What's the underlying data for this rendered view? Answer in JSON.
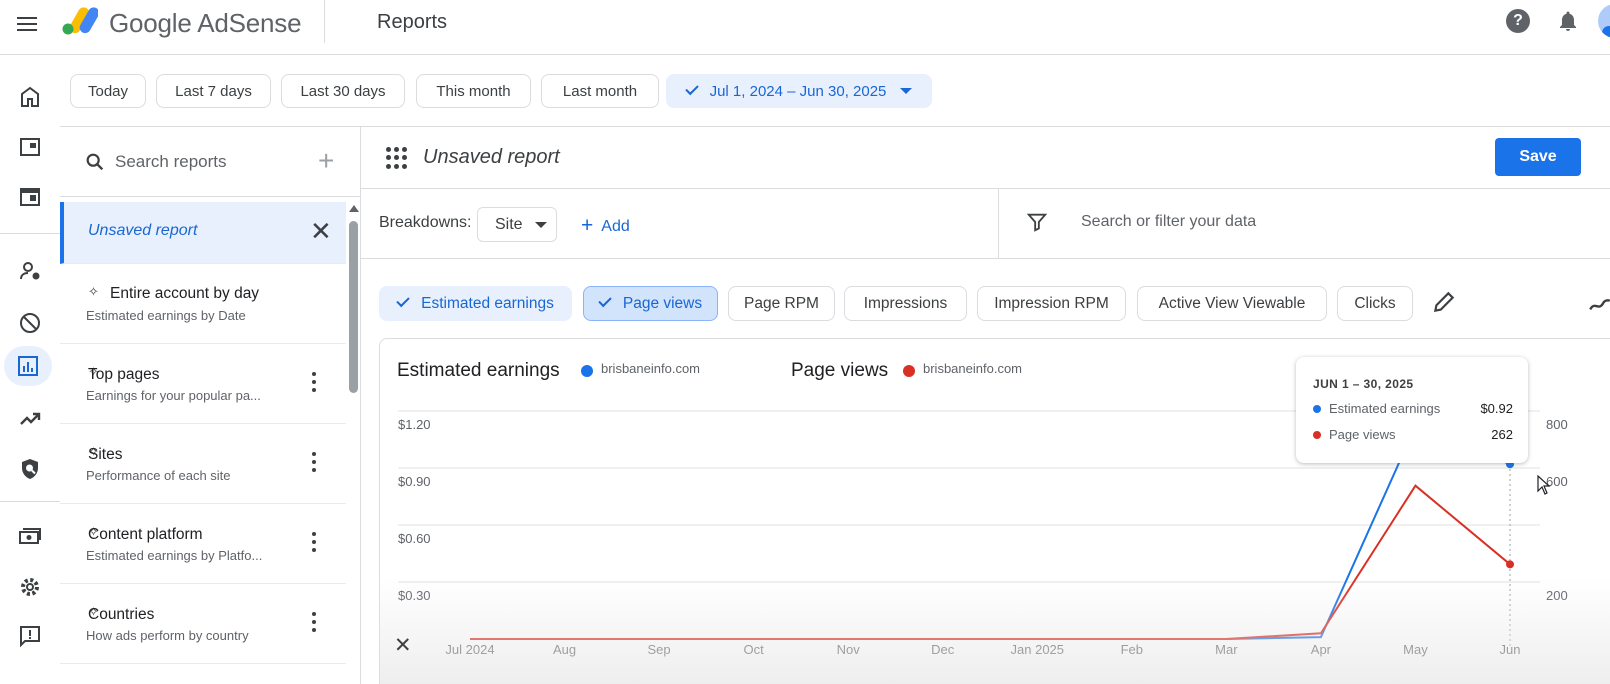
{
  "header": {
    "brand": "Google AdSense",
    "page_title": "Reports"
  },
  "rail": {
    "icons": [
      "home-icon",
      "ads-icon",
      "layout-icon",
      "users-icon",
      "block-icon",
      "reports-icon",
      "optimization-icon",
      "policy-icon",
      "payments-icon",
      "settings-icon",
      "feedback-icon"
    ],
    "active": "reports-icon"
  },
  "date_filters": {
    "chips": [
      "Today",
      "Last 7 days",
      "Last 30 days",
      "This month",
      "Last month"
    ],
    "selected_range": "Jul 1, 2024 – Jun 30, 2025"
  },
  "reports_panel": {
    "search_placeholder": "Search reports",
    "active_report": "Unsaved report",
    "items": [
      {
        "title": "Entire account by day",
        "subtitle": "Estimated earnings by Date"
      },
      {
        "title": "Top pages",
        "subtitle": "Earnings for your popular pa..."
      },
      {
        "title": "Sites",
        "subtitle": "Performance of each site"
      },
      {
        "title": "Content platform",
        "subtitle": "Estimated earnings by Platfo..."
      },
      {
        "title": "Countries",
        "subtitle": "How ads perform by country"
      }
    ]
  },
  "report": {
    "name": "Unsaved report",
    "save_label": "Save",
    "breakdowns_label": "Breakdowns:",
    "breakdown_value": "Site",
    "add_label": "Add",
    "filter_placeholder": "Search or filter your data",
    "metrics": [
      {
        "label": "Estimated earnings",
        "selected": true
      },
      {
        "label": "Page views",
        "selected": true
      },
      {
        "label": "Page RPM",
        "selected": false
      },
      {
        "label": "Impressions",
        "selected": false
      },
      {
        "label": "Impression RPM",
        "selected": false
      },
      {
        "label": "Active View Viewable",
        "selected": false
      },
      {
        "label": "Clicks",
        "selected": false
      }
    ]
  },
  "chart_legend": {
    "left_title": "Estimated earnings",
    "left_site": "brisbaneinfo.com",
    "right_title": "Page views",
    "right_site": "brisbaneinfo.com"
  },
  "tooltip": {
    "heading": "JUN 1 – 30, 2025",
    "rows": [
      {
        "label": "Estimated earnings",
        "value": "$0.92"
      },
      {
        "label": "Page views",
        "value": "262"
      }
    ]
  },
  "colors": {
    "earnings": "#1a73e8",
    "pageviews": "#d93025",
    "accent": "#1a73e8"
  },
  "chart_data": {
    "type": "line",
    "categories": [
      "Jul 2024",
      "Aug",
      "Sep",
      "Oct",
      "Nov",
      "Dec",
      "Jan 2025",
      "Feb",
      "Mar",
      "Apr",
      "May",
      "Jun"
    ],
    "series": [
      {
        "name": "Estimated earnings",
        "axis": "left",
        "values": [
          0,
          0,
          0,
          0,
          0,
          0,
          0,
          0,
          0,
          0.01,
          1.12,
          0.92
        ]
      },
      {
        "name": "Page views",
        "axis": "right",
        "values": [
          0,
          0,
          0,
          0,
          0,
          0,
          0,
          0,
          0,
          20,
          538,
          262
        ]
      }
    ],
    "left_ticks": [
      "$0.30",
      "$0.60",
      "$0.90",
      "$1.20"
    ],
    "left_tick_values": [
      0.3,
      0.6,
      0.9,
      1.2
    ],
    "right_ticks": [
      "200",
      "600",
      "800"
    ],
    "right_tick_values": [
      200,
      600,
      800
    ],
    "ylim_left": [
      0,
      1.2
    ],
    "ylim_right": [
      0,
      800
    ],
    "grid": true
  }
}
